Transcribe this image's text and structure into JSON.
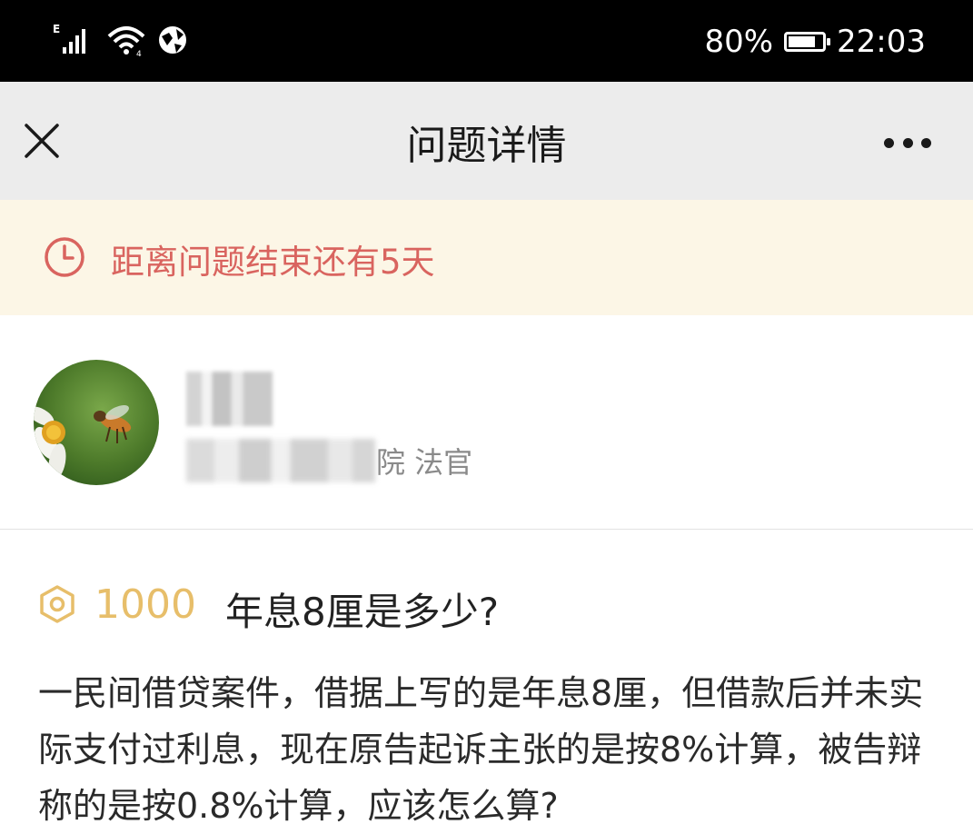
{
  "status_bar": {
    "network": "E",
    "battery": "80%",
    "battery_level": 0.8,
    "time": "22:03"
  },
  "nav": {
    "title": "问题详情",
    "close_icon": "close-icon",
    "more_icon": "more-icon"
  },
  "notice": {
    "icon": "clock-icon",
    "text": "距离问题结束还有5天",
    "color": "#d9645f",
    "background": "#fcf6e6"
  },
  "user": {
    "org_suffix": "院",
    "role": "法官",
    "user_title": "院 法官"
  },
  "question": {
    "reward_icon": "reward-hexagon-icon",
    "reward": "1000",
    "reward_color": "#e7be6a",
    "title": "年息8厘是多少?",
    "body": "一民间借贷案件，借据上写的是年息8厘，但借款后并未实际支付过利息，现在原告起诉主张的是按8%计算，被告辩称的是按0.8%计算，应该怎么算?"
  }
}
